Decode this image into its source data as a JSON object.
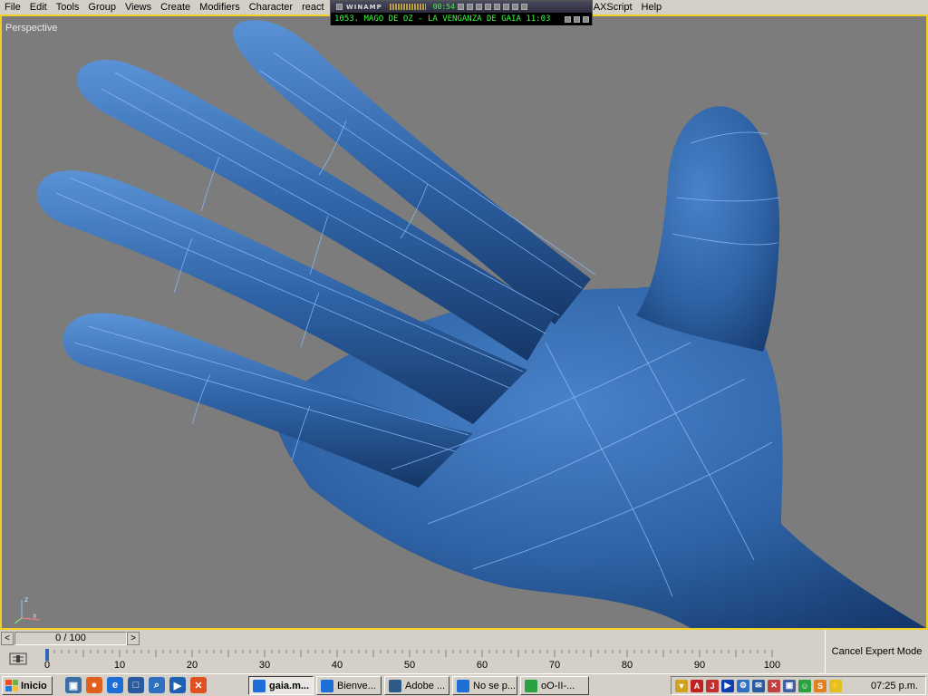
{
  "menubar": {
    "items": [
      "File",
      "Edit",
      "Tools",
      "Group",
      "Views",
      "Create",
      "Modifiers",
      "Character",
      "react"
    ],
    "items_right": [
      "MAXScript",
      "Help"
    ]
  },
  "winamp": {
    "logo": "WINAMP",
    "time": "00:54",
    "track": "1053. MAGO DE OZ - LA VENGANZA DE GAIA  11:03"
  },
  "viewport": {
    "label": "Perspective",
    "border_color": "#f0d020",
    "model_color": "#2f63a6"
  },
  "timeslider": {
    "prev_arrow": "<",
    "next_arrow": ">",
    "frame_display": "0 / 100"
  },
  "trackbar": {
    "ticks": [
      "0",
      "10",
      "20",
      "30",
      "40",
      "50",
      "60",
      "70",
      "80",
      "90",
      "100"
    ],
    "cancel_expert_label": "Cancel Expert Mode"
  },
  "taskbar": {
    "start_label": "Inicio",
    "quicklaunch": [
      "desktop-icon",
      "firefox-icon",
      "ie-icon",
      "explorer-icon",
      "search-icon",
      "media-icon",
      "xampp-icon"
    ],
    "tasks": [
      {
        "label": "gaia.m...",
        "active": true,
        "icon": "3dsmax-icon"
      },
      {
        "label": "Bienve...",
        "active": false,
        "icon": "ie-icon"
      },
      {
        "label": "Adobe ...",
        "active": false,
        "icon": "adobe-icon"
      },
      {
        "label": "No se p...",
        "active": false,
        "icon": "ie-icon"
      },
      {
        "label": "oO-II-...",
        "active": false,
        "icon": "messenger-icon"
      }
    ],
    "clock": "07:25 p.m."
  }
}
